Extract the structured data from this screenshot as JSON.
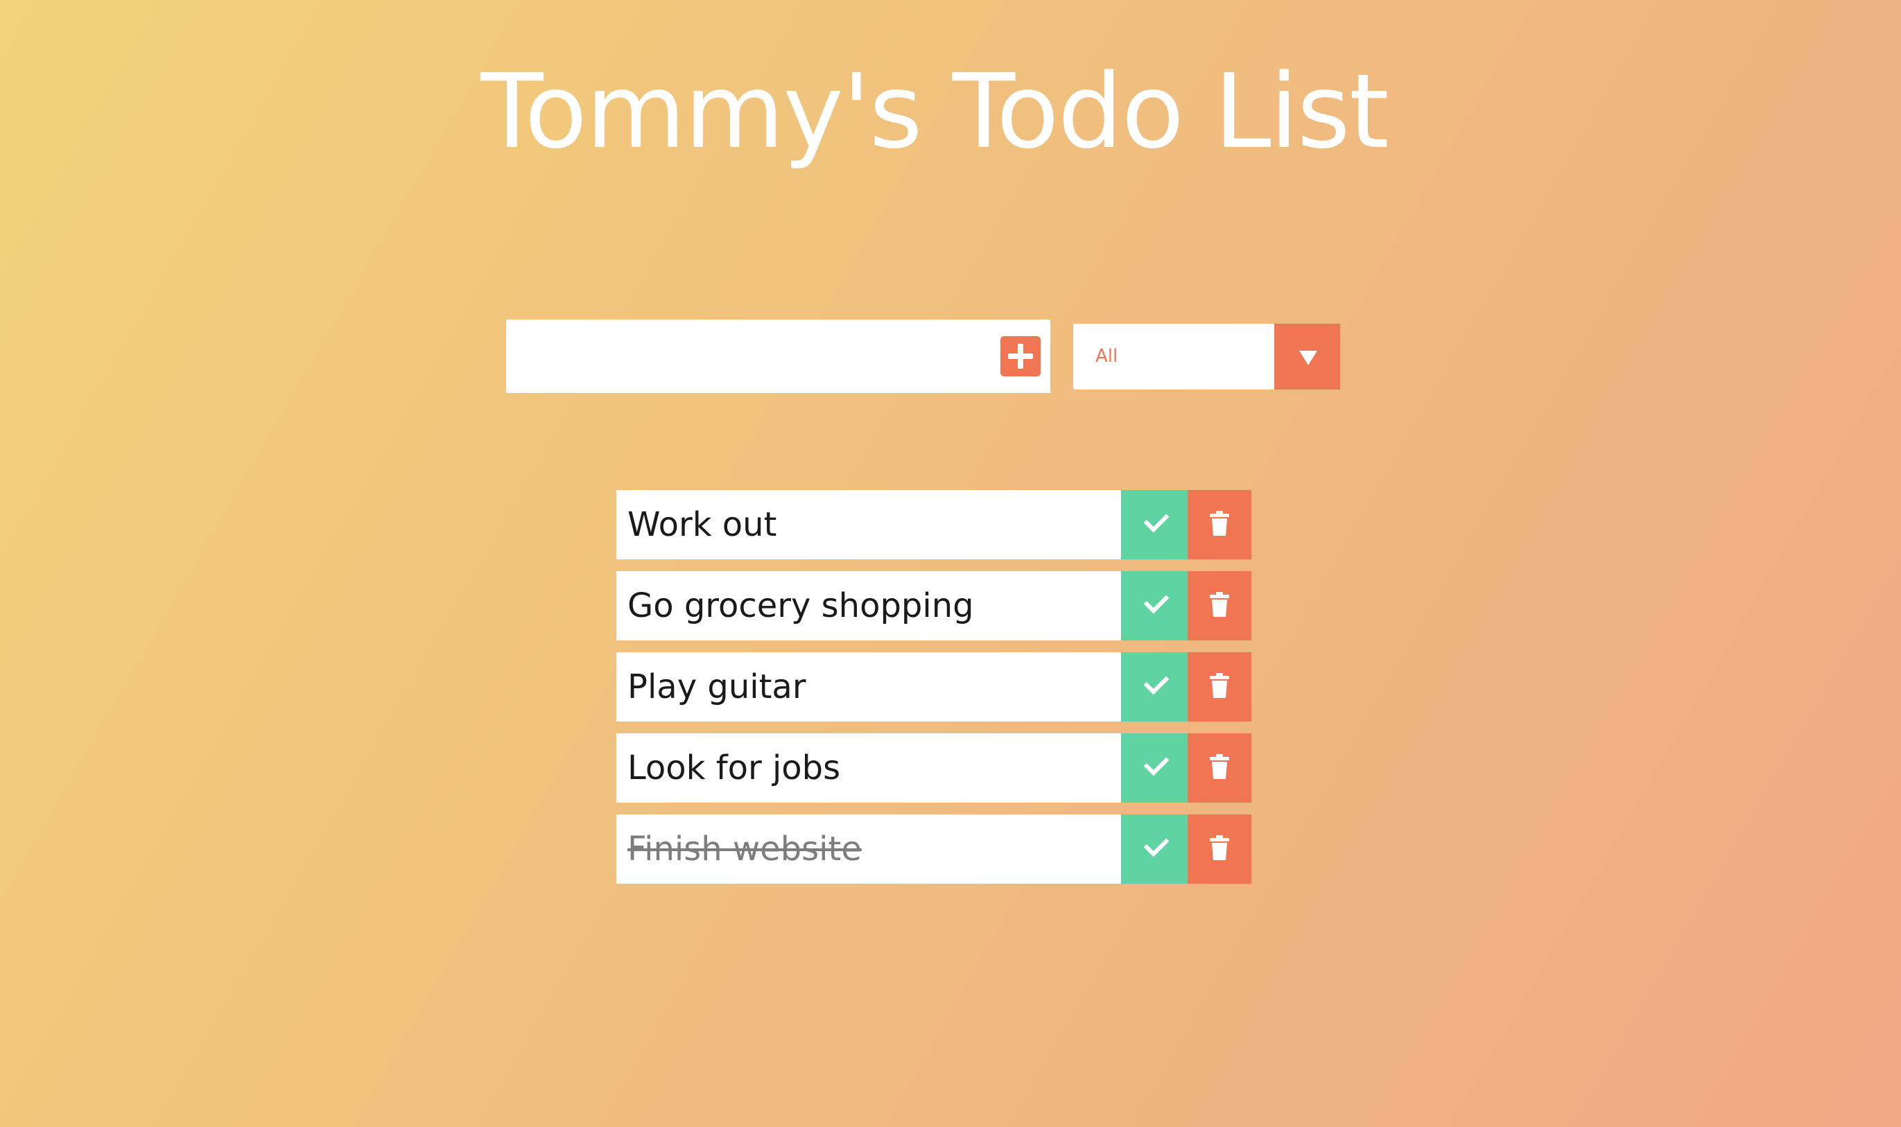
{
  "app": {
    "title": "Tommy's Todo List"
  },
  "add_form": {
    "input_value": "",
    "placeholder": "",
    "add_icon": "plus-icon"
  },
  "filter": {
    "selected": "All",
    "arrow_icon": "caret-down-icon"
  },
  "todos": [
    {
      "text": "Work out",
      "completed": false
    },
    {
      "text": "Go grocery shopping",
      "completed": false
    },
    {
      "text": "Play guitar",
      "completed": false
    },
    {
      "text": "Look for jobs",
      "completed": false
    },
    {
      "text": "Finish website",
      "completed": true
    }
  ],
  "icons": {
    "complete": "check-icon",
    "delete": "trash-icon"
  },
  "colors": {
    "accent": "#f07653",
    "complete": "#5fd3a2",
    "background_start": "#f3d27a",
    "background_end": "#f0a885",
    "completed_text": "#7d7d7d"
  }
}
